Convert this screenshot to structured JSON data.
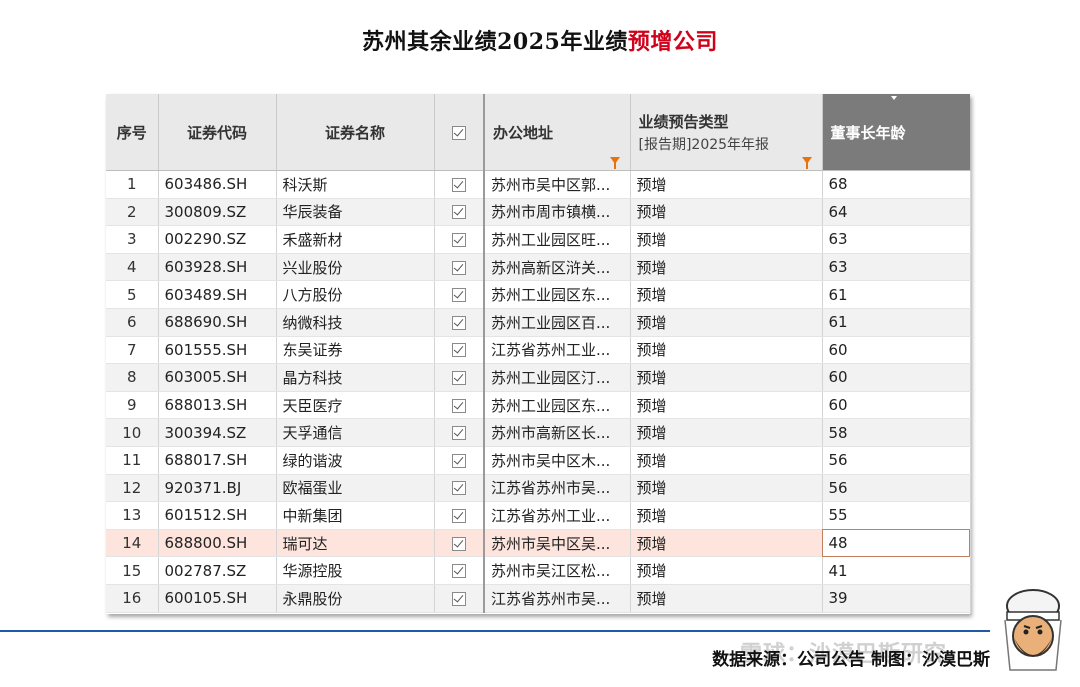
{
  "title": {
    "prefix": "苏州其余业绩2025年业绩",
    "highlight": "预增公司"
  },
  "table": {
    "headers": {
      "seq": "序号",
      "code": "证券代码",
      "name": "证券名称",
      "address": "办公地址",
      "forecast": "业绩预告类型",
      "forecast_sub": "[报告期]2025年年报",
      "age": "董事长年龄"
    },
    "rows": [
      {
        "no": "1",
        "code": "603486.SH",
        "name": "科沃斯",
        "address": "苏州市吴中区郭...",
        "type": "预增",
        "age": "68"
      },
      {
        "no": "2",
        "code": "300809.SZ",
        "name": "华辰装备",
        "address": "苏州市周市镇横...",
        "type": "预增",
        "age": "64"
      },
      {
        "no": "3",
        "code": "002290.SZ",
        "name": "禾盛新材",
        "address": "苏州工业园区旺...",
        "type": "预增",
        "age": "63"
      },
      {
        "no": "4",
        "code": "603928.SH",
        "name": "兴业股份",
        "address": "苏州高新区浒关...",
        "type": "预增",
        "age": "63"
      },
      {
        "no": "5",
        "code": "603489.SH",
        "name": "八方股份",
        "address": "苏州工业园区东...",
        "type": "预增",
        "age": "61"
      },
      {
        "no": "6",
        "code": "688690.SH",
        "name": "纳微科技",
        "address": "苏州工业园区百...",
        "type": "预增",
        "age": "61"
      },
      {
        "no": "7",
        "code": "601555.SH",
        "name": "东吴证券",
        "address": "江苏省苏州工业...",
        "type": "预增",
        "age": "60"
      },
      {
        "no": "8",
        "code": "603005.SH",
        "name": "晶方科技",
        "address": "苏州工业园区汀...",
        "type": "预增",
        "age": "60"
      },
      {
        "no": "9",
        "code": "688013.SH",
        "name": "天臣医疗",
        "address": "苏州工业园区东...",
        "type": "预增",
        "age": "60"
      },
      {
        "no": "10",
        "code": "300394.SZ",
        "name": "天孚通信",
        "address": "苏州市高新区长...",
        "type": "预增",
        "age": "58"
      },
      {
        "no": "11",
        "code": "688017.SH",
        "name": "绿的谐波",
        "address": "苏州市吴中区木...",
        "type": "预增",
        "age": "56"
      },
      {
        "no": "12",
        "code": "920371.BJ",
        "name": "欧福蛋业",
        "address": "江苏省苏州市吴...",
        "type": "预增",
        "age": "56"
      },
      {
        "no": "13",
        "code": "601512.SH",
        "name": "中新集团",
        "address": "江苏省苏州工业...",
        "type": "预增",
        "age": "55"
      },
      {
        "no": "14",
        "code": "688800.SH",
        "name": "瑞可达",
        "address": "苏州市吴中区吴...",
        "type": "预增",
        "age": "48"
      },
      {
        "no": "15",
        "code": "002787.SZ",
        "name": "华源控股",
        "address": "苏州市吴江区松...",
        "type": "预增",
        "age": "41"
      },
      {
        "no": "16",
        "code": "600105.SH",
        "name": "永鼎股份",
        "address": "江苏省苏州市吴...",
        "type": "预增",
        "age": "39"
      }
    ],
    "selected_row": "14"
  },
  "footer": {
    "source": "数据来源：公司公告  制图：沙漠巴斯",
    "watermark": "雪球：沙漠巴斯研究"
  }
}
